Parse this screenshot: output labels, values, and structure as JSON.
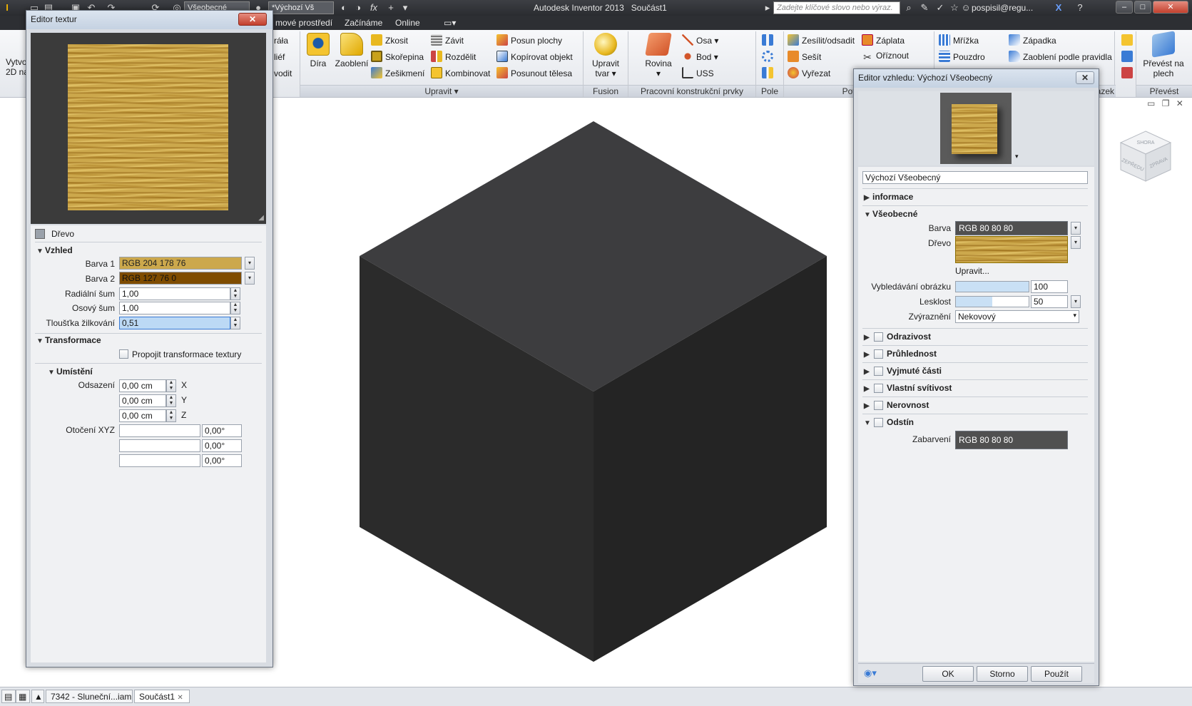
{
  "titlebar": {
    "app_name": "Autodesk Inventor 2013",
    "document": "Součást1",
    "qa_combo_1": "Všeobecné",
    "qa_combo_2": "*Výchozí Vš",
    "search_placeholder": "Zadejte klíčové slovo nebo výraz.",
    "user": "pospisil@regu...",
    "minimize": "–",
    "maximize": "□",
    "close": "✕"
  },
  "menubar": {
    "tabs": [
      "mové prostředí",
      "Začínáme",
      "Online"
    ]
  },
  "ribbon": {
    "left_items": [
      "Vytvo",
      "2D ná",
      "ráła",
      "liéf",
      "vodit"
    ],
    "modify": {
      "hole": "Díra",
      "fillet": "Zaoblení",
      "chamfer": "Zkosit",
      "shell": "Skořepina",
      "draft": "Zešikmení",
      "thread": "Závit",
      "split": "Rozdělit",
      "combine": "Kombinovat",
      "move_face": "Posun plochy",
      "copy_object": "Kopírovat objekt",
      "move_bodies": "Posunout tělesa",
      "group_label": "Upravit"
    },
    "fusion": {
      "edit_form_1": "Upravit",
      "edit_form_2": "tvar",
      "group_label": "Fusion"
    },
    "work_features": {
      "plane": "Rovina",
      "axis": "Osa",
      "point": "Bod",
      "ucs": "USS",
      "group_label": "Pracovní konstrukční prvky"
    },
    "pattern": {
      "group_label": "Pole"
    },
    "surface": {
      "thicken": "Zesílit/odsadit",
      "stitch": "Sešít",
      "sculpt": "Vyřezat",
      "patch": "Záplata",
      "trim": "Oříznout",
      "group_label": "Povrch"
    },
    "plastic": {
      "grid": "Mřížka",
      "boss": "Pouzdro",
      "snap": "Západka",
      "rule_fillet": "Zaoblení podle pravidla"
    },
    "convert": {
      "label_1": "Převést na",
      "label_2": "plech",
      "group_label": "Převést"
    },
    "vazek_label": "vazek"
  },
  "texture_editor": {
    "title": "Editor textur",
    "material": "Dřevo",
    "appearance": {
      "header": "Vzhled",
      "color1_label": "Barva 1",
      "color1_value": "RGB 204 178 76",
      "color1_hex": "#cca84c",
      "color2_label": "Barva 2",
      "color2_value": "RGB 127 76 0",
      "color2_hex": "#7f4c00",
      "radial_noise_label": "Radiální šum",
      "radial_noise_value": "1,00",
      "axial_noise_label": "Osový šum",
      "axial_noise_value": "1,00",
      "grain_thickness_label": "Tloušťka žilkování",
      "grain_thickness_value": "0,51"
    },
    "transform": {
      "header": "Transformace",
      "link_label": "Propojit transformace textury"
    },
    "placement": {
      "header": "Umístění",
      "offset_label": "Odsazení",
      "offset_x": "0,00 cm",
      "offset_y": "0,00 cm",
      "offset_z": "0,00 cm",
      "axis_x": "X",
      "axis_y": "Y",
      "axis_z": "Z",
      "rotation_label": "Otočení XYZ",
      "rot_x": "0,00°",
      "rot_y": "0,00°",
      "rot_z": "0,00°"
    }
  },
  "appearance_editor": {
    "title": "Editor vzhledu: Výchozí Všeobecný",
    "name": "Výchozí Všeobecný",
    "info_header": "informace",
    "general_header": "Všeobecné",
    "color_label": "Barva",
    "color_value": "RGB 80 80 80",
    "color_hex": "#505050",
    "wood_label": "Dřevo",
    "edit_link": "Upravit...",
    "image_fade_label": "Vybledávání obrázku",
    "image_fade_value": "100",
    "gloss_label": "Lesklost",
    "gloss_value": "50",
    "highlight_label": "Zvýraznění",
    "highlight_value": "Nekovový",
    "sections": [
      "Odrazivost",
      "Průhlednost",
      "Vyjmuté části",
      "Vlastní svítivost",
      "Nerovnost"
    ],
    "tint_header": "Odstín",
    "tint_label": "Zabarvení",
    "tint_value": "RGB 80 80 80",
    "ok": "OK",
    "cancel": "Storno",
    "apply": "Použít"
  },
  "viewcube": {
    "top": "SHORA",
    "front": "ZEPŘEDU",
    "right": "ZPRAVA"
  },
  "bottom_tabs": [
    "7342 - Sluneční...iam",
    "Součást1"
  ]
}
